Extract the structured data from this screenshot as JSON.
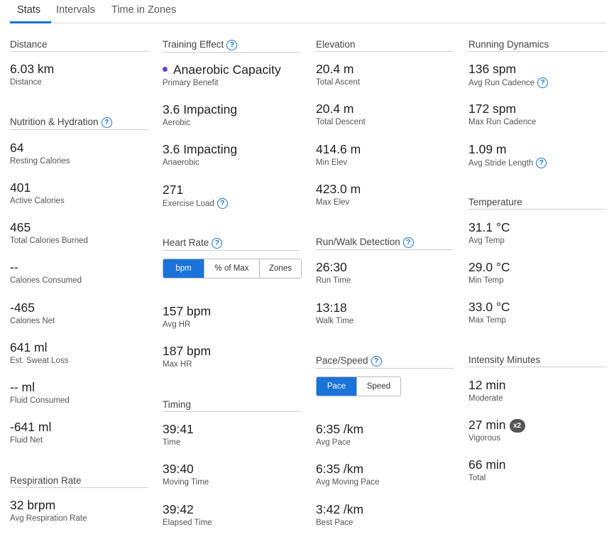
{
  "tabs": [
    {
      "label": "Stats"
    },
    {
      "label": "Intervals"
    },
    {
      "label": "Time in Zones"
    }
  ],
  "col1": {
    "distance": {
      "title": "Distance",
      "stats": [
        {
          "value": "6.03 km",
          "label": "Distance"
        }
      ]
    },
    "nutrition": {
      "title": "Nutrition & Hydration",
      "stats": [
        {
          "value": "64",
          "label": "Resting Calories"
        },
        {
          "value": "401",
          "label": "Active Calories"
        },
        {
          "value": "465",
          "label": "Total Calories Burned"
        },
        {
          "value": "--",
          "label": "Calories Consumed"
        },
        {
          "value": "-465",
          "label": "Calories Net"
        },
        {
          "value": "641 ml",
          "label": "Est. Sweat Loss"
        },
        {
          "value": "-- ml",
          "label": "Fluid Consumed"
        },
        {
          "value": "-641 ml",
          "label": "Fluid Net"
        }
      ]
    },
    "respiration": {
      "title": "Respiration Rate",
      "stats": [
        {
          "value": "32 brpm",
          "label": "Avg Respiration Rate"
        }
      ]
    }
  },
  "col2": {
    "training_effect": {
      "title": "Training Effect",
      "primary": {
        "value": "Anaerobic Capacity",
        "label": "Primary Benefit",
        "dot_color": "#6f3fd1"
      },
      "stats": [
        {
          "value": "3.6 Impacting",
          "label": "Aerobic"
        },
        {
          "value": "3.6 Impacting",
          "label": "Anaerobic"
        },
        {
          "value": "271",
          "label": "Exercise Load"
        }
      ]
    },
    "heart_rate": {
      "title": "Heart Rate",
      "toggle": [
        {
          "label": "bpm",
          "active": true
        },
        {
          "label": "% of Max",
          "active": false
        },
        {
          "label": "Zones",
          "active": false
        }
      ],
      "stats": [
        {
          "value": "157 bpm",
          "label": "Avg HR"
        },
        {
          "value": "187 bpm",
          "label": "Max HR"
        }
      ]
    },
    "timing": {
      "title": "Timing",
      "stats": [
        {
          "value": "39:41",
          "label": "Time"
        },
        {
          "value": "39:40",
          "label": "Moving Time"
        },
        {
          "value": "39:42",
          "label": "Elapsed Time"
        }
      ]
    }
  },
  "col3": {
    "elevation": {
      "title": "Elevation",
      "stats": [
        {
          "value": "20.4 m",
          "label": "Total Ascent"
        },
        {
          "value": "20.4 m",
          "label": "Total Descent"
        },
        {
          "value": "414.6 m",
          "label": "Min Elev"
        },
        {
          "value": "423.0 m",
          "label": "Max Elev"
        }
      ]
    },
    "run_walk": {
      "title": "Run/Walk Detection",
      "stats": [
        {
          "value": "26:30",
          "label": "Run Time"
        },
        {
          "value": "13:18",
          "label": "Walk Time"
        }
      ]
    },
    "pace_speed": {
      "title": "Pace/Speed",
      "toggle": [
        {
          "label": "Pace",
          "active": true
        },
        {
          "label": "Speed",
          "active": false
        }
      ],
      "stats": [
        {
          "value": "6:35 /km",
          "label": "Avg Pace"
        },
        {
          "value": "6:35 /km",
          "label": "Avg Moving Pace"
        },
        {
          "value": "3:42 /km",
          "label": "Best Pace"
        }
      ]
    }
  },
  "col4": {
    "running_dynamics": {
      "title": "Running Dynamics",
      "stats": [
        {
          "value": "136 spm",
          "label": "Avg Run Cadence"
        },
        {
          "value": "172 spm",
          "label": "Max Run Cadence"
        },
        {
          "value": "1.09 m",
          "label": "Avg Stride Length"
        }
      ]
    },
    "temperature": {
      "title": "Temperature",
      "stats": [
        {
          "value": "31.1 °C",
          "label": "Avg Temp"
        },
        {
          "value": "29.0 °C",
          "label": "Min Temp"
        },
        {
          "value": "33.0 °C",
          "label": "Max Temp"
        }
      ]
    },
    "intensity": {
      "title": "Intensity Minutes",
      "stats": [
        {
          "value": "12 min",
          "label": "Moderate"
        },
        {
          "value": "27 min",
          "label": "Vigorous",
          "badge": "x2"
        },
        {
          "value": "66 min",
          "label": "Total"
        }
      ]
    }
  },
  "help_glyph": "?",
  "colors": {
    "accent": "#1a73d8",
    "primary_dot": "#6f3fd1",
    "badge_bg": "#555555"
  }
}
